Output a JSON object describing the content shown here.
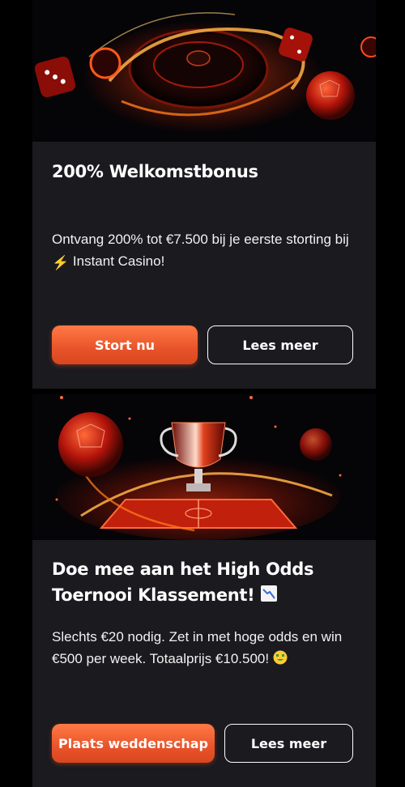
{
  "promos": [
    {
      "banner_icon": "roulette-casino-banner",
      "title": "200% Welkomstbonus",
      "description": "Ontvang 200% tot €7.500 bij je eerste storting bij",
      "description_emoji": "⚡",
      "description_suffix": " Instant Casino!",
      "primary_label": "Stort nu",
      "secondary_label": "Lees meer"
    },
    {
      "banner_icon": "trophy-football-banner",
      "title": "Doe mee aan het High Odds Toernooi Klassement!",
      "title_emoji": "📉",
      "description": "Slechts €20 nodig. Zet in met hoge odds en win €500 per week. Totaalprijs €10.500!",
      "description_emoji": "🤑",
      "primary_label": "Plaats weddenschap",
      "secondary_label": "Lees meer"
    }
  ],
  "colors": {
    "card_bg": "#1a1a1f",
    "accent": "#ee5a2c",
    "page_bg": "#000000"
  }
}
